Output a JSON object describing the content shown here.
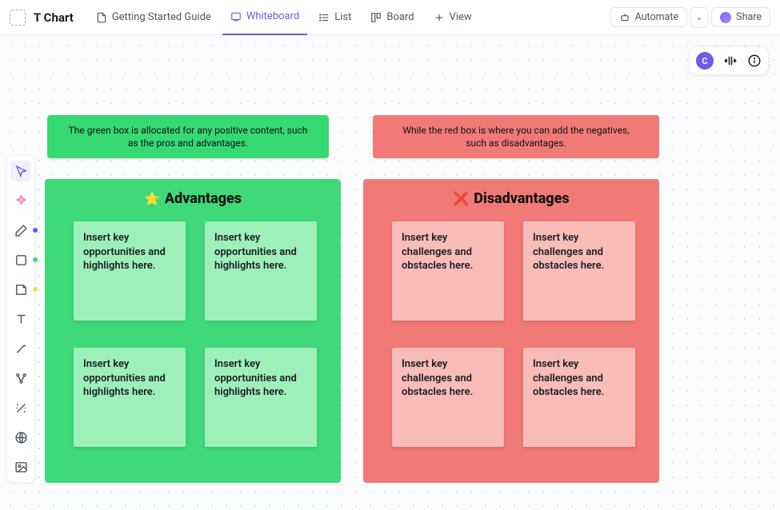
{
  "header": {
    "title": "T Chart",
    "tabs": {
      "guide": "Getting Started Guide",
      "whiteboard": "Whiteboard",
      "list": "List",
      "board": "Board",
      "view": "View"
    },
    "automate": "Automate",
    "share": "Share"
  },
  "right_pill": {
    "avatar_letter": "C"
  },
  "strips": {
    "green": "The green box is allocated for any positive content, such as the pros and advantages.",
    "red": "While the red box is where you can add the negatives, such as disadvantages."
  },
  "panels": {
    "advantages": {
      "icon": "⭐",
      "title": "Advantages",
      "cards": [
        "Insert key opportunities and highlights here.",
        "Insert key opportunities and highlights here.",
        "Insert key opportunities and highlights here.",
        "Insert key opportunities and highlights here."
      ]
    },
    "disadvantages": {
      "icon": "❌",
      "title": "Disadvantages",
      "cards": [
        "Insert key challenges and obstacles here.",
        "Insert key challenges and obstacles here.",
        "Insert key challenges and obstacles here.",
        "Insert key challenges and obstacles here."
      ]
    }
  }
}
